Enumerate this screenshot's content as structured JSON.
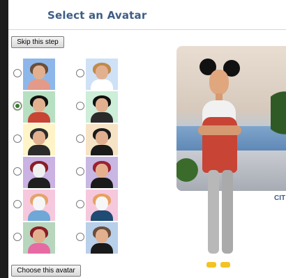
{
  "page": {
    "title": "Select an Avatar"
  },
  "buttons": {
    "skip_label": "Skip this step",
    "choose_label": "Choose this avatar"
  },
  "preview": {
    "caption": "CIT"
  },
  "avatars": [
    {
      "id": "a1",
      "selected": false,
      "style": {
        "bg": "#8db7ea",
        "skin": "#e2b08f",
        "hair": "#6b4e3a",
        "outfit": "#e39a88"
      }
    },
    {
      "id": "a2",
      "selected": false,
      "style": {
        "bg": "#cfe1f6",
        "skin": "#e2b08f",
        "hair": "#c08a4b",
        "outfit": "#ffffff"
      }
    },
    {
      "id": "a3",
      "selected": true,
      "style": {
        "bg": "#b7e0c2",
        "skin": "#e2b08f",
        "hair": "#111111",
        "outfit": "#c84435"
      }
    },
    {
      "id": "a4",
      "selected": false,
      "style": {
        "bg": "#cdeed8",
        "skin": "#e2b08f",
        "hair": "#111111",
        "outfit": "#2b2b2b"
      }
    },
    {
      "id": "a5",
      "selected": false,
      "style": {
        "bg": "#fff4c8",
        "skin": "#e2b08f",
        "hair": "#2b2b2b",
        "outfit": "#2a2a2a"
      }
    },
    {
      "id": "a6",
      "selected": false,
      "style": {
        "bg": "#f6e3c5",
        "skin": "#e2b08f",
        "hair": "#1a1a1a",
        "outfit": "#1a1a1a"
      }
    },
    {
      "id": "a7",
      "selected": false,
      "style": {
        "bg": "#cab2e3",
        "skin": "#f0f0f0",
        "hair": "#8b1d25",
        "outfit": "#1f1f1f"
      }
    },
    {
      "id": "a8",
      "selected": false,
      "style": {
        "bg": "#c8b6e3",
        "skin": "#e6b08f",
        "hair": "#9a2230",
        "outfit": "#1a1a1a"
      }
    },
    {
      "id": "a9",
      "selected": false,
      "style": {
        "bg": "#f6c8dd",
        "skin": "#f6f6f6",
        "hair": "#e5a36a",
        "outfit": "#6fa7d7"
      }
    },
    {
      "id": "a10",
      "selected": false,
      "style": {
        "bg": "#f6c8dd",
        "skin": "#f6f6f6",
        "hair": "#e7a060",
        "outfit": "#1f4b74"
      }
    },
    {
      "id": "a11",
      "selected": false,
      "style": {
        "bg": "#b7d6bd",
        "skin": "#e2b08f",
        "hair": "#8b1d25",
        "outfit": "#e66aa3"
      }
    },
    {
      "id": "a12",
      "selected": false,
      "style": {
        "bg": "#b9d0ea",
        "skin": "#e2b08f",
        "hair": "#6b4e3a",
        "outfit": "#1a1a1a"
      }
    }
  ]
}
